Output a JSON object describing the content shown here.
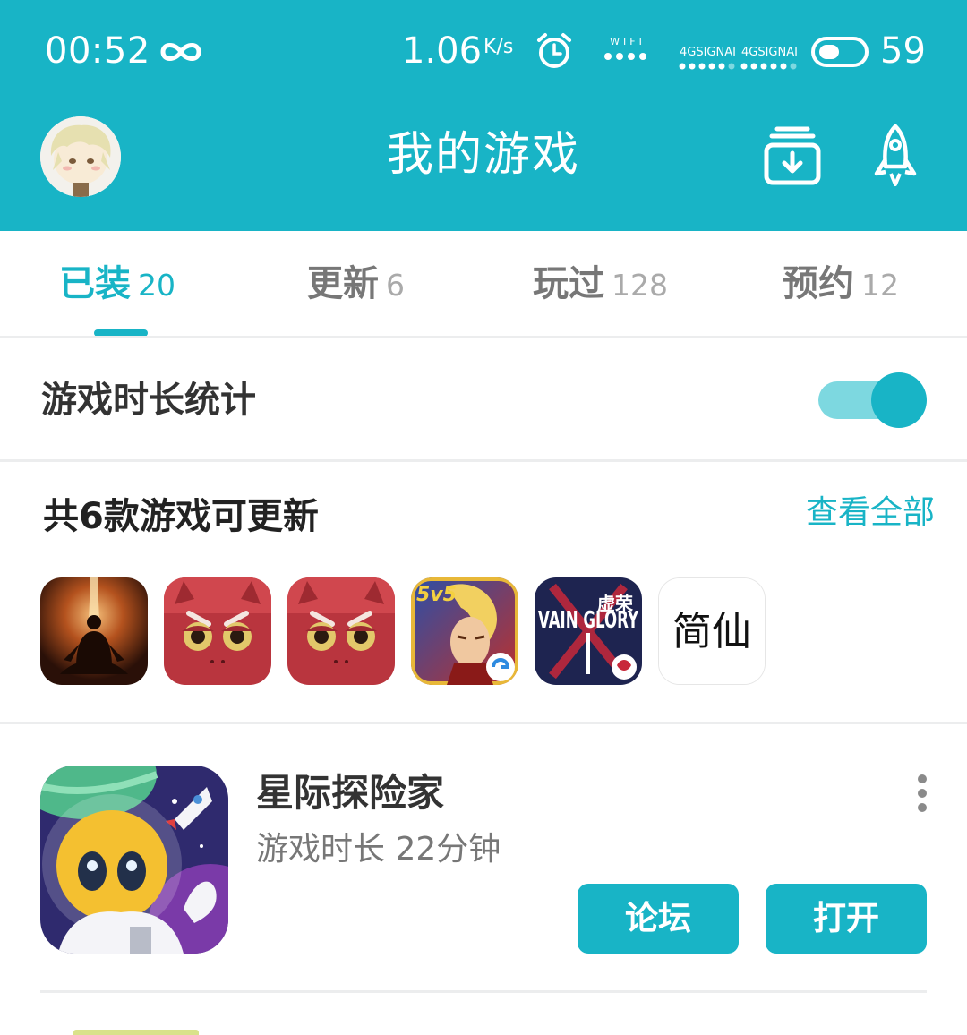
{
  "status_bar": {
    "time": "00:52",
    "net_speed": "1.06",
    "net_speed_unit": "K/s",
    "wifi_label": "WIFI",
    "signal_label": "4GSIGNAI",
    "battery": "59"
  },
  "header": {
    "title": "我的游戏",
    "icons": [
      "avatar",
      "download-manager-icon",
      "rocket-icon"
    ]
  },
  "tabs": [
    {
      "label": "已装",
      "count": "20",
      "active": true
    },
    {
      "label": "更新",
      "count": "6",
      "active": false
    },
    {
      "label": "玩过",
      "count": "128",
      "active": false
    },
    {
      "label": "预约",
      "count": "12",
      "active": false
    }
  ],
  "playtime_stats": {
    "label": "游戏时长统计",
    "enabled": true
  },
  "updates": {
    "title": "共6款游戏可更新",
    "view_all": "查看全部",
    "icons": [
      {
        "name": "meditating-monk-game-icon"
      },
      {
        "name": "red-monster-game-icon-1"
      },
      {
        "name": "red-monster-game-icon-2"
      },
      {
        "name": "honor-of-kings-game-icon",
        "badge": "5v5"
      },
      {
        "name": "vainglory-game-icon",
        "text": "VAIN GLORY",
        "text2": "虚荣"
      },
      {
        "name": "jian-xian-game-icon",
        "text": "简仙"
      }
    ]
  },
  "game_card": {
    "name": "星际探险家",
    "playtime_label": "游戏时长",
    "playtime": "22分钟",
    "forum_button": "论坛",
    "open_button": "打开"
  },
  "colors": {
    "accent": "#18B4C6",
    "accent_light": "#7DD8E0",
    "text_dark": "#333333",
    "text_gray": "#777777",
    "divider": "#ECEDEE"
  }
}
